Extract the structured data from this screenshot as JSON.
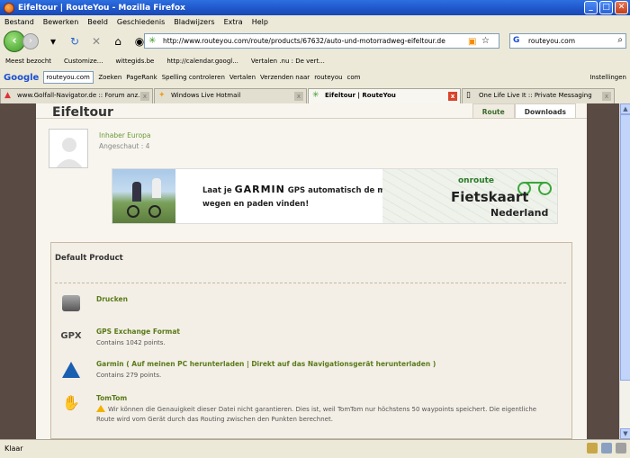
{
  "window": {
    "title": "Eifeltour | RouteYou - Mozilla Firefox"
  },
  "menu": [
    "Bestand",
    "Bewerken",
    "Beeld",
    "Geschiedenis",
    "Bladwijzers",
    "Extra",
    "Help"
  ],
  "nav": {
    "url": "http://www.routeyou.com/route/products/67632/auto-und-motorradweg-eifeltour.de",
    "search_value": "routeyou.com"
  },
  "bookmarks": [
    "Meest bezocht",
    "Customize...",
    "wittegids.be",
    "http://calendar.googl...",
    "Vertalen .nu : De vert..."
  ],
  "google_bar": {
    "logo": "Google",
    "search_value": "routeyou.com",
    "items": [
      "Zoeken",
      "PageRank",
      "Spelling controleren",
      "Vertalen",
      "Verzenden naar",
      "routeyou",
      "com",
      "Instellingen"
    ]
  },
  "tabs": [
    {
      "label": "www.Golfall-Navigator.de :: Forum anz...",
      "icon": "warning-icon"
    },
    {
      "label": "Windows Live Hotmail",
      "icon": "hotmail-icon"
    },
    {
      "label": "Eifeltour | RouteYou",
      "icon": "routeyou-icon",
      "active": true
    },
    {
      "label": "One Life Live It :: Private Messaging",
      "icon": "page-icon"
    }
  ],
  "page": {
    "title": "Eifeltour",
    "tabs": [
      "Route",
      "Downloads"
    ],
    "active_tab": "Downloads",
    "owner_label": "Inhaber Europa",
    "views": "Angeschaut : 4",
    "banner": {
      "line1_pre": "Laat je",
      "brand": "GARMIN",
      "line1_post": "GPS automatisch de mooiste",
      "line2": "wegen en paden vinden!",
      "onroute": "onroute",
      "fietskaart": "Fietskaart",
      "nederland": "Nederland"
    },
    "section_title": "Default Product",
    "items": [
      {
        "icon": "printer-icon",
        "label": "Drucken"
      },
      {
        "icon": "gpx-icon",
        "icon_text": "GPX",
        "label": "GPS Exchange Format",
        "sub": "Contains 1042 points."
      },
      {
        "icon": "garmin-icon",
        "label": "Garmin ( Auf meinen PC herunterladen | Direkt auf das Navigationsgerät herunterladen )",
        "sub": "Contains 279 points."
      },
      {
        "icon": "tomtom-icon",
        "label": "TomTom",
        "desc": "Wir können die Genauigkeit dieser Datei nicht garantieren. Dies ist, weil TomTom nur höchstens 50 waypoints speichert. Die eigentliche Route wird vom Gerät durch das Routing zwischen den Punkten berechnet."
      }
    ]
  },
  "status": {
    "text": "Klaar"
  }
}
